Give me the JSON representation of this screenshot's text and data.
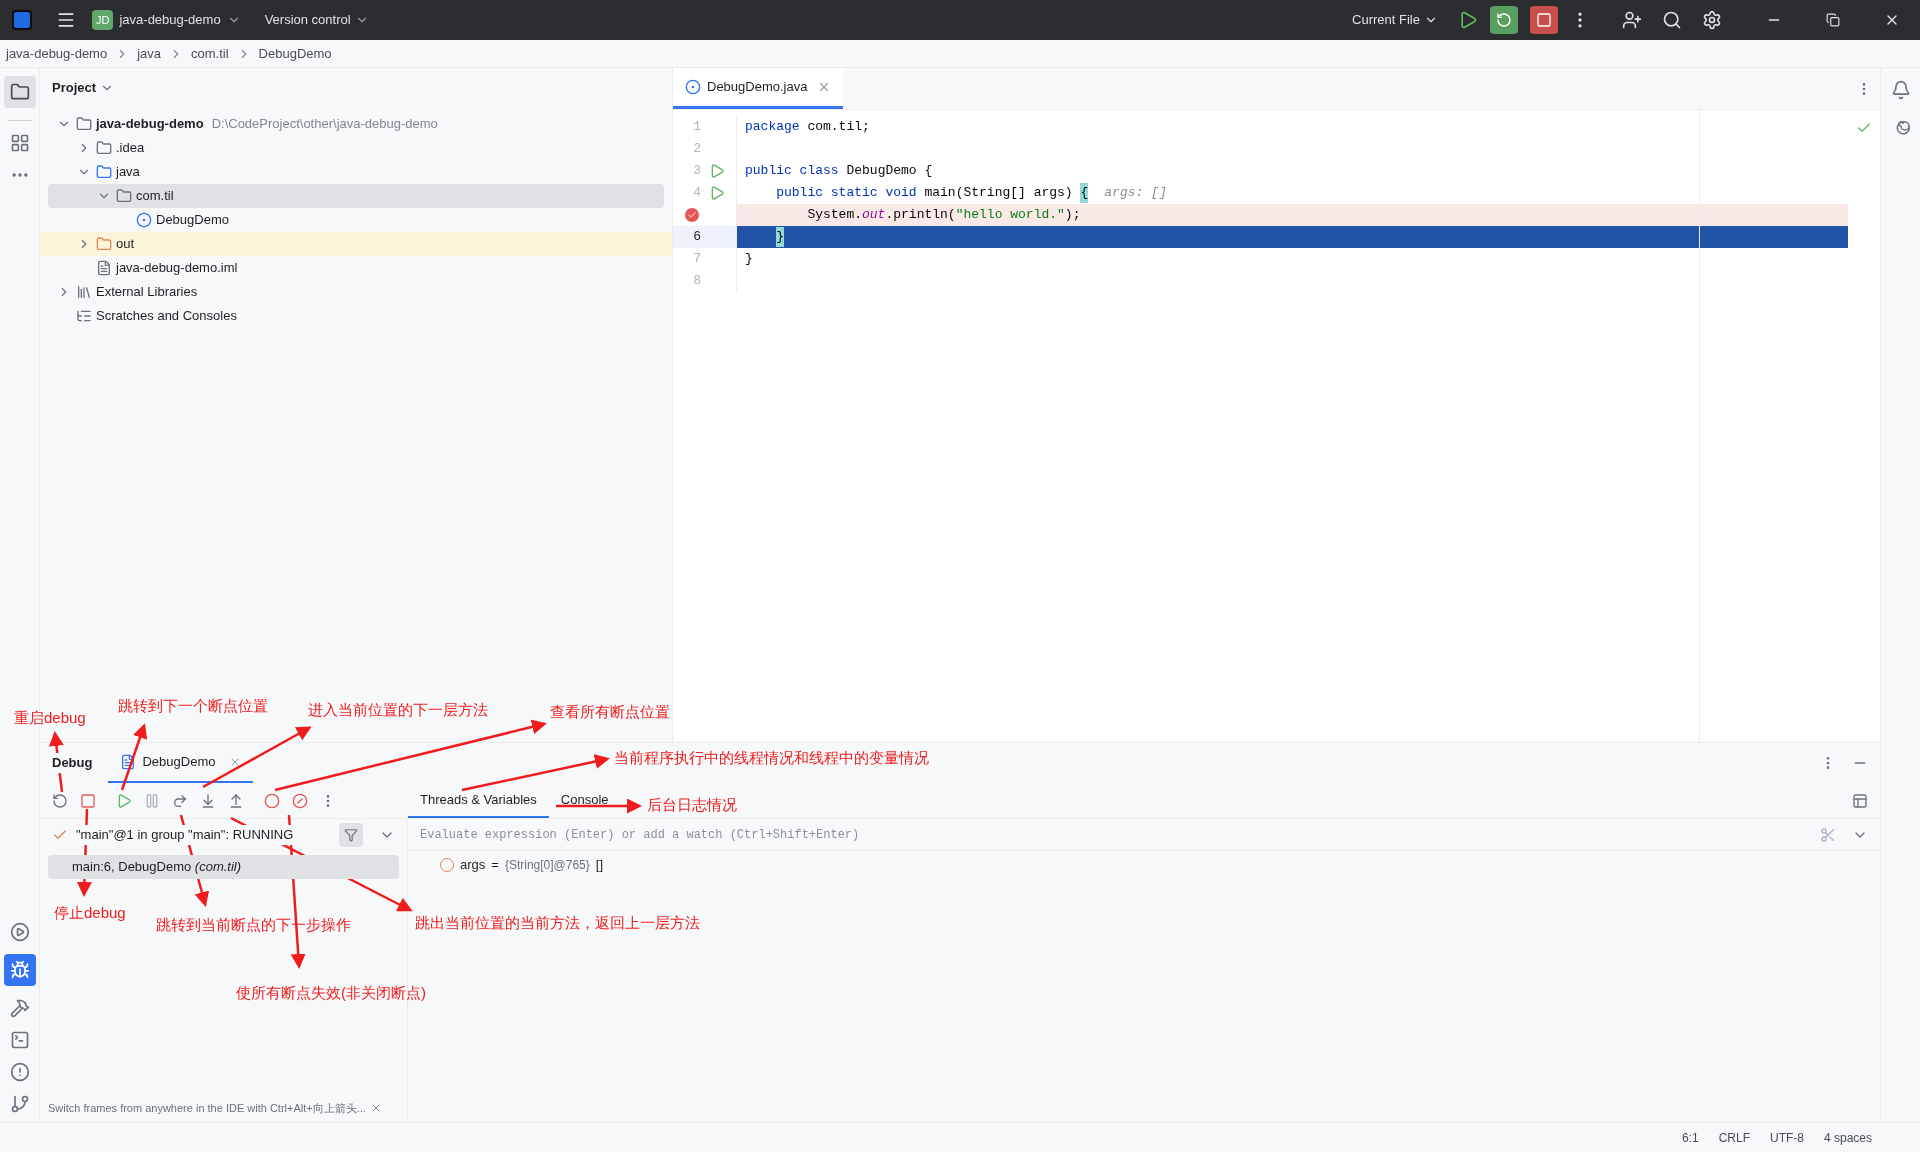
{
  "title_bar": {
    "project_badge": "JD",
    "project": "java-debug-demo",
    "vcs": "Version control",
    "run_config": "Current File"
  },
  "breadcrumbs": [
    "java-debug-demo",
    "java",
    "com.til",
    "DebugDemo"
  ],
  "project_panel": {
    "title": "Project",
    "tree": [
      {
        "label": "java-debug-demo",
        "path": "D:\\CodeProject\\other\\java-debug-demo",
        "kind": "module",
        "expanded": true,
        "selected": false,
        "children": [
          {
            "label": ".idea",
            "kind": "folder",
            "expanded": false,
            "selected": false
          },
          {
            "label": "java",
            "kind": "source",
            "expanded": true,
            "selected": false,
            "children": [
              {
                "label": "com.til",
                "kind": "package",
                "expanded": true,
                "selected": true,
                "children": [
                  {
                    "label": "DebugDemo",
                    "kind": "class",
                    "selected": false
                  }
                ]
              }
            ]
          },
          {
            "label": "out",
            "kind": "excluded",
            "expanded": false,
            "selected": false
          },
          {
            "label": "java-debug-demo.iml",
            "kind": "file",
            "selected": false
          }
        ]
      },
      {
        "label": "External Libraries",
        "kind": "library",
        "expanded": false,
        "selected": false
      },
      {
        "label": "Scratches and Consoles",
        "kind": "scratches",
        "selected": false
      }
    ]
  },
  "editor": {
    "tabs": [
      {
        "label": "DebugDemo.java",
        "selected": true
      }
    ],
    "lines": [
      {
        "number": "1",
        "tokens": [
          {
            "text": "package",
            "kind": "keyword"
          },
          {
            "text": " com.til;",
            "kind": "plain"
          }
        ]
      },
      {
        "number": "2"
      },
      {
        "number": "3",
        "run": true,
        "tokens": [
          {
            "text": "public class",
            "kind": "keyword"
          },
          {
            "text": " DebugDemo ",
            "kind": "plain"
          },
          {
            "text": "{",
            "kind": "open_brace",
            "matched": false
          }
        ]
      },
      {
        "number": "4",
        "run": true,
        "tokens": [
          {
            "text": "public static void",
            "kind": "keyword"
          },
          {
            "text": " main(String[] args) ",
            "kind": "plain"
          },
          {
            "text": "{",
            "kind": "open_brace",
            "matched": true
          }
        ],
        "hint": "args: []"
      },
      {
        "breakpoint": true,
        "tokens": [
          {
            "text": "System.",
            "kind": "plain"
          },
          {
            "text": "out",
            "kind": "field"
          },
          {
            "text": ".println(",
            "kind": "plain"
          },
          {
            "text": "\"hello world.\"",
            "kind": "string"
          },
          {
            "text": ");",
            "kind": "plain"
          }
        ]
      },
      {
        "number": "6",
        "current": true,
        "tokens": [
          {
            "text": "}",
            "kind": "close_brace",
            "matched": true
          }
        ]
      },
      {
        "number": "7",
        "tokens": [
          {
            "text": "}",
            "kind": "close_brace",
            "matched": false
          }
        ]
      },
      {
        "number": "8"
      }
    ]
  },
  "debug": {
    "title": "Debug",
    "sessions": [
      {
        "label": "DebugDemo",
        "selected": true
      }
    ],
    "views": [
      {
        "label": "Threads & Variables",
        "selected": true
      },
      {
        "label": "Console",
        "selected": false
      }
    ],
    "thread": "\"main\"@1 in group \"main\": RUNNING",
    "frames": [
      {
        "label": "main:6, DebugDemo *(com.til)*",
        "selected": true
      }
    ],
    "evaluate_placeholder": "Evaluate expression (Enter) or add a watch (Ctrl+Shift+Enter)",
    "variables": [
      {
        "name": "args",
        "equals": "=",
        "value": "{String[0]@765}",
        "extra": "[]"
      }
    ],
    "hint": "Switch frames from anywhere in the IDE with Ctrl+Alt+向上箭头..."
  },
  "status_bar": [
    "6:1",
    "CRLF",
    "UTF-8",
    "4 spaces"
  ],
  "annotations": [
    "重启debug",
    "跳转到下一个断点位置",
    "进入当前位置的下一层方法",
    "查看所有断点位置",
    "当前程序执行中的线程情况和线程中的变量情况",
    "后台日志情况",
    "停止debug",
    "跳转到当前断点的下一步操作",
    "跳出当前位置的当前方法，返回上一层方法",
    "使所有断点失效(非关闭断点)"
  ]
}
